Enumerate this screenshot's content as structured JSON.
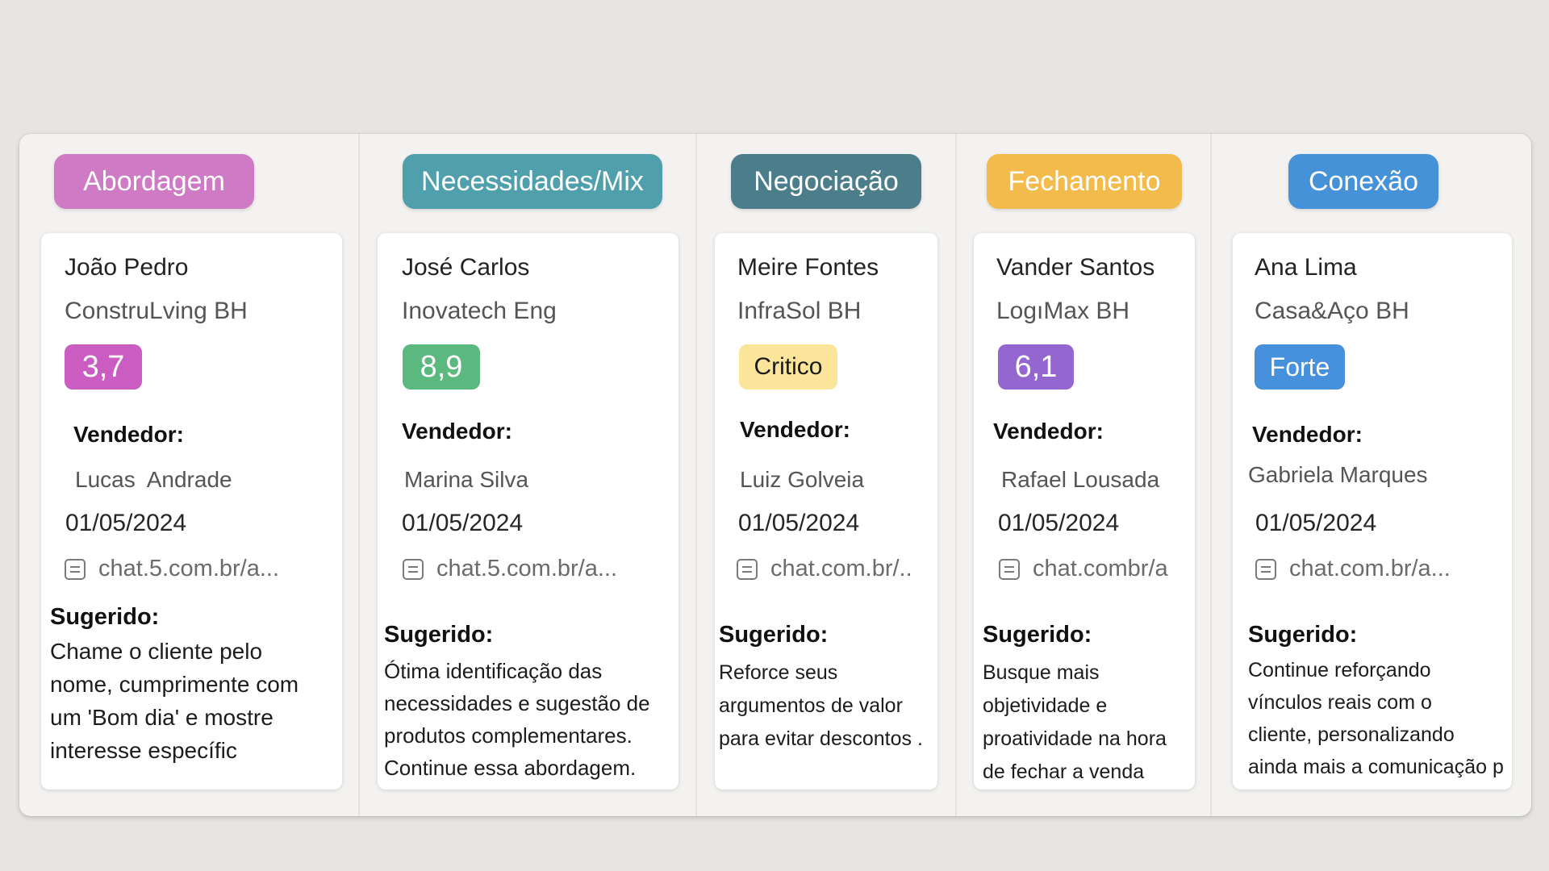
{
  "columns": [
    {
      "stage": "Abordagem",
      "stage_color": "#cf7ac5",
      "client": "João Pedro",
      "company": "ConstruLving BH",
      "score": "3,7",
      "score_color": "#cb5cc2",
      "seller_label": "Vendedor:",
      "seller": "Lucas  Andrade",
      "date": "01/05/2024",
      "link": "chat.5.com.br/a...",
      "link_icon": "document-icon",
      "suggested_label": "Sugerido:",
      "suggested_text": "Chame o cliente pelo\nnome, cumprimente com\num 'Bom dia' e mostre\ninteresse específic"
    },
    {
      "stage": "Necessidades/Mix",
      "stage_color": "#4f9fad",
      "client": "José Carlos",
      "company": "Inovatech Eng",
      "score": "8,9",
      "score_color": "#5bb87e",
      "seller_label": "Vendedor:",
      "seller": "Marina Silva",
      "date": "01/05/2024",
      "link": "chat.5.com.br/a...",
      "link_icon": "document-icon",
      "suggested_label": "Sugerido:",
      "suggested_text": "Ótima identificação das\nnecessidades e sugestão de\nprodutos complementares.\nContinue essa abordagem."
    },
    {
      "stage": "Negociação",
      "stage_color": "#4c7d8b",
      "client": "Meire Fontes",
      "company": "InfraSol BH",
      "score": "Critico",
      "score_color": "#fbe59a",
      "seller_label": "Vendedor:",
      "seller": "Luiz Golveia",
      "date": "01/05/2024",
      "link": "chat.com.br/..",
      "link_icon": "document-icon",
      "suggested_label": "Sugerido:",
      "suggested_text": "Reforce seus\nargumentos de valor\npara evitar descontos ."
    },
    {
      "stage": "Fechamento",
      "stage_color": "#f3bb4c",
      "client": "Vander Santos",
      "company": "LogıMax BH",
      "score": "6,1",
      "score_color": "#9466d0",
      "seller_label": "Vendedor:",
      "seller": "Rafael Lousada",
      "date": "01/05/2024",
      "link": "chat.combr/a",
      "link_icon": "document-icon",
      "suggested_label": "Sugerido:",
      "suggested_text": "Busque mais\nobjetividade e\nproatividade na hora\nde fechar a venda"
    },
    {
      "stage": "Conexão",
      "stage_color": "#4592d8",
      "client": "Ana Lima",
      "company": "Casa&Aço BH",
      "score": "Forte",
      "score_color": "#4791dc",
      "seller_label": "Vendedor:",
      "seller": "Gabriela Marques",
      "date": "01/05/2024",
      "link": "chat.com.br/a...",
      "link_icon": "document-icon",
      "suggested_label": "Sugerido:",
      "suggested_text": "Continue reforçando\nvínculos reais com o\ncliente, personalizando\nainda mais a comunicação p"
    }
  ]
}
